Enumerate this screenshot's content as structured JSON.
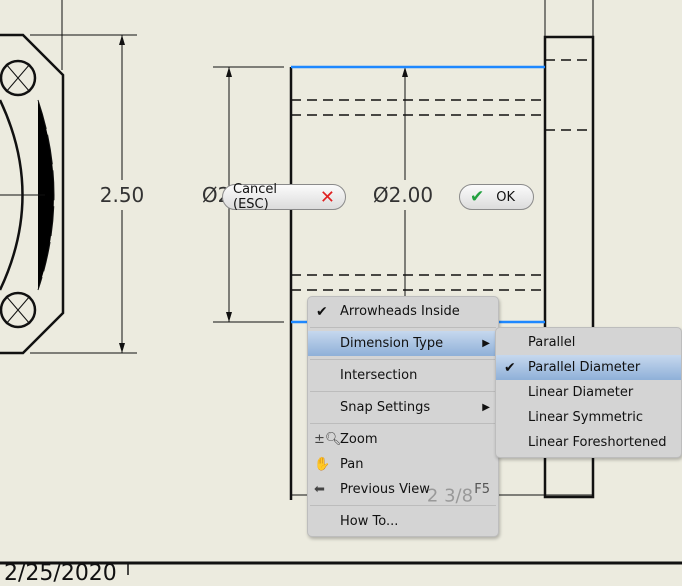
{
  "drawing": {
    "dim_left": "2.50",
    "dim_dia_left": "Ø2.00",
    "dim_dia_center": "Ø2.00",
    "dim_bottom": "2 3/8",
    "title_block_date": "2/25/2020"
  },
  "buttons": {
    "cancel": "Cancel (ESC)",
    "ok": "OK"
  },
  "context_menu": {
    "items": [
      {
        "label": "Arrowheads Inside",
        "checked": true
      },
      {
        "label": "Dimension Type",
        "submenu": true
      },
      {
        "label": "Intersection"
      },
      {
        "label": "Snap Settings",
        "submenu": true
      },
      {
        "label": "Zoom",
        "icon": "zoom-icon"
      },
      {
        "label": "Pan",
        "icon": "hand-icon"
      },
      {
        "label": "Previous View",
        "icon": "previous-view-icon",
        "shortcut": "F5"
      },
      {
        "label": "How To..."
      }
    ]
  },
  "submenu": {
    "items": [
      {
        "label": "Parallel"
      },
      {
        "label": "Parallel Diameter",
        "checked": true
      },
      {
        "label": "Linear Diameter"
      },
      {
        "label": "Linear Symmetric"
      },
      {
        "label": "Linear Foreshortened"
      }
    ]
  },
  "colors": {
    "background": "#ecebdf",
    "selection": "#1e88ff",
    "cancel": "#e02020",
    "ok": "#22a040"
  }
}
